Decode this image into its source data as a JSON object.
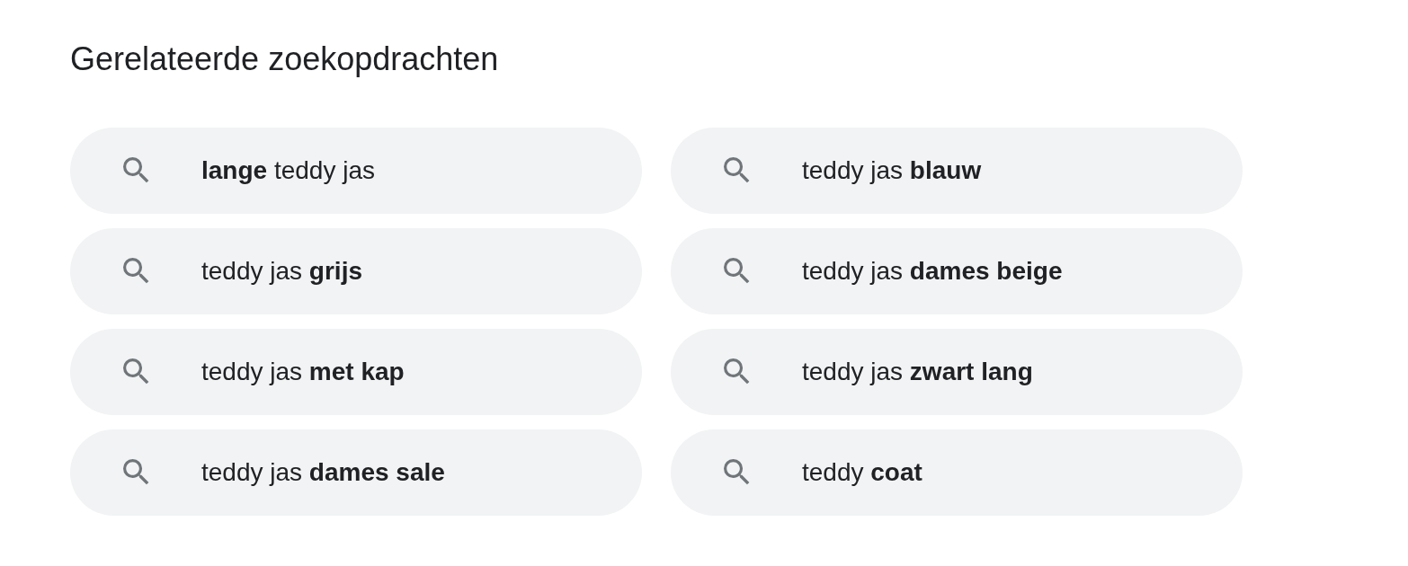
{
  "heading": "Gerelateerde zoekopdrachten",
  "related_searches": [
    {
      "text": "**lange** teddy jas"
    },
    {
      "text": "teddy jas **blauw**"
    },
    {
      "text": "teddy jas **grijs**"
    },
    {
      "text": "teddy jas **dames beige**"
    },
    {
      "text": "teddy jas **met kap**"
    },
    {
      "text": "teddy jas **zwart lang**"
    },
    {
      "text": "teddy jas **dames sale**"
    },
    {
      "text": "teddy **coat**"
    }
  ]
}
